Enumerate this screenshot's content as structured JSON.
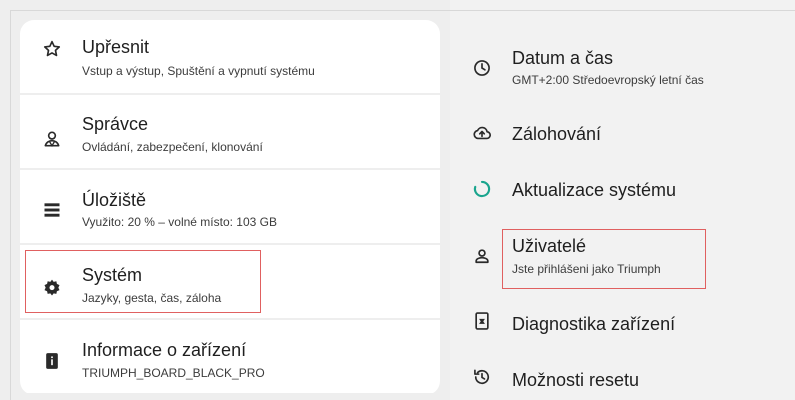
{
  "left_menu": {
    "items": [
      {
        "title": "Upřesnit",
        "subtitle": "Vstup a výstup, Spuštění a vypnutí systému",
        "icon": "star-outline-icon"
      },
      {
        "title": "Správce",
        "subtitle": "Ovládání, zabezpečení, klonování",
        "icon": "admin-person-icon"
      },
      {
        "title": "Úložiště",
        "subtitle": "Využito: 20 % – volné místo: 103 GB",
        "icon": "storage-icon"
      },
      {
        "title": "Systém",
        "subtitle": "Jazyky, gesta, čas, záloha",
        "icon": "gear-icon"
      },
      {
        "title": "Informace o zařízení",
        "subtitle": "TRIUMPH_BOARD_BLACK_PRO",
        "icon": "device-info-icon"
      }
    ]
  },
  "right_menu": {
    "items": [
      {
        "title": "Datum a čas",
        "subtitle": "GMT+2:00 Středoevropský letní čas",
        "icon": "clock-icon"
      },
      {
        "title": "Zálohování",
        "subtitle": "",
        "icon": "cloud-backup-icon"
      },
      {
        "title": "Aktualizace systému",
        "subtitle": "",
        "icon": "system-update-icon"
      },
      {
        "title": "Uživatelé",
        "subtitle": "Jste přihlášeni jako Triumph",
        "icon": "user-icon"
      },
      {
        "title": "Diagnostika zařízení",
        "subtitle": "",
        "icon": "diagnostics-icon"
      },
      {
        "title": "Možnosti resetu",
        "subtitle": "",
        "icon": "reset-history-icon"
      }
    ]
  },
  "colors": {
    "accent_update": "#1aa58e",
    "highlight_box": "#e06060"
  }
}
